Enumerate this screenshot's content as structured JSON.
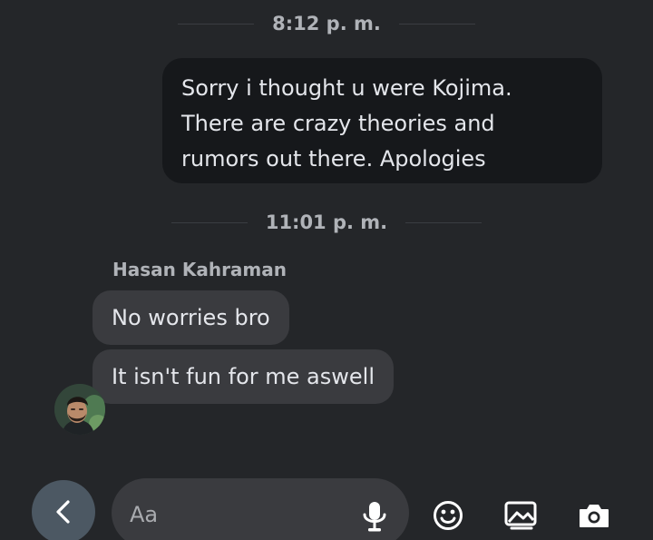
{
  "messages": [
    {
      "timestamp": "8:12 p. m.",
      "direction": "outgoing",
      "text": "Sorry i thought u were Kojima.\nThere are crazy theories and\nrumors out there. Apologies"
    },
    {
      "timestamp": "11:01 p. m.",
      "sender": "Hasan Kahraman",
      "direction": "incoming",
      "bubbles": [
        "No worries bro",
        "It isn't fun for me aswell"
      ]
    }
  ],
  "composer": {
    "placeholder": "Aa",
    "icons": [
      "back-icon",
      "microphone-icon",
      "emoji-icon",
      "gallery-icon",
      "camera-icon"
    ]
  },
  "colors": {
    "background": "#242629",
    "outgoing_bubble": "#16181b",
    "incoming_bubble": "#3a3b3f",
    "back_button": "#4c5863",
    "text": "#e4e6eb",
    "muted_text": "#b0b3b8"
  }
}
